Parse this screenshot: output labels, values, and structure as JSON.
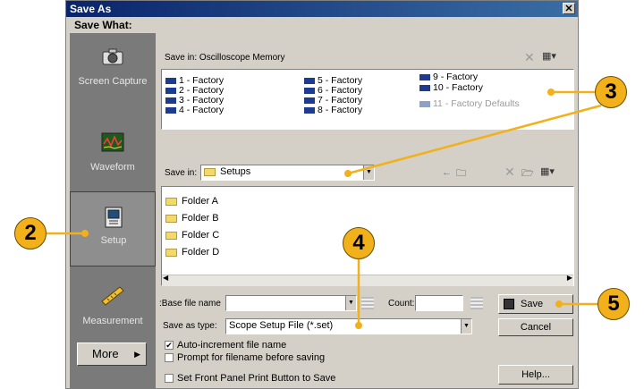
{
  "dialog": {
    "title": "Save As",
    "save_what_label": "Save What:"
  },
  "sidebar": {
    "items": [
      {
        "label": "Screen Capture",
        "icon": "camera-icon"
      },
      {
        "label": "Waveform",
        "icon": "waveform-icon"
      },
      {
        "label": "Setup",
        "icon": "setup-icon",
        "selected": true
      },
      {
        "label": "Measurement",
        "icon": "ruler-icon"
      }
    ],
    "more_label": "More"
  },
  "memory": {
    "save_in_label": "Save in:",
    "location": "Oscilloscope Memory",
    "slots": [
      "1 - Factory",
      "2 - Factory",
      "3 - Factory",
      "4 - Factory",
      "5 - Factory",
      "6 - Factory",
      "7 - Factory",
      "8 - Factory",
      "9 - Factory",
      "10 - Factory",
      "11 - Factory Defaults"
    ]
  },
  "files": {
    "save_in_label": "Save in:",
    "location": "Setups",
    "folders": [
      "Folder A",
      "Folder B",
      "Folder C",
      "Folder D"
    ],
    "file_name_label": "Base file name:",
    "file_name_value": "",
    "count_label": "Count:",
    "count_value": "",
    "save_as_type_label": "Save as type:",
    "save_as_type_value": "Scope Setup File (*.set)"
  },
  "buttons": {
    "save": "Save",
    "cancel": "Cancel",
    "help": "Help..."
  },
  "options": {
    "auto_increment": "Auto-increment file name",
    "auto_increment_checked": true,
    "prompt": "Prompt for filename before saving",
    "prompt_checked": false,
    "front_panel": "Set Front Panel Print Button to Save",
    "front_panel_checked": false
  },
  "callouts": [
    "2",
    "3",
    "4",
    "5"
  ],
  "colors": {
    "callout": "#f2b01a",
    "title_bar": "#0a246a",
    "sidebar": "#7a7a7a"
  }
}
